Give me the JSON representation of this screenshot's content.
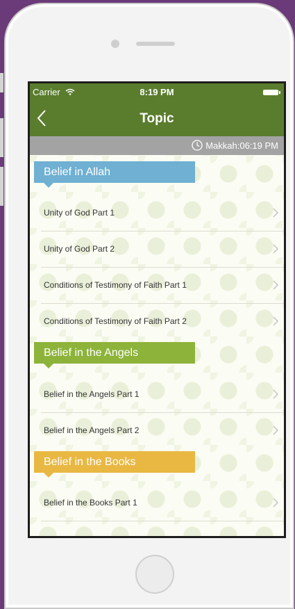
{
  "status_bar": {
    "carrier": "Carrier",
    "time": "8:19 PM",
    "wifi_icon": "wifi-icon",
    "battery_icon": "battery-icon"
  },
  "nav": {
    "title": "Topic",
    "back_icon": "chevron-left-icon",
    "color": "#5a7d2d"
  },
  "prayer_time": {
    "label": "Makkah:06:19 PM",
    "icon": "clock-icon"
  },
  "sections": [
    {
      "title": "Belief in Allah",
      "color": "#6fb0d3",
      "items": [
        "Unity of God Part 1",
        "Unity of God Part 2",
        "Conditions of Testimony of Faith Part 1",
        "Conditions of Testimony of Faith Part 2"
      ]
    },
    {
      "title": "Belief in the Angels",
      "color": "#8db33a",
      "items": [
        "Belief in the Angels Part 1",
        "Belief in the Angels Part 2"
      ]
    },
    {
      "title": "Belief in the Books",
      "color": "#e9b843",
      "items": [
        "Belief in the Books Part 1"
      ]
    }
  ]
}
